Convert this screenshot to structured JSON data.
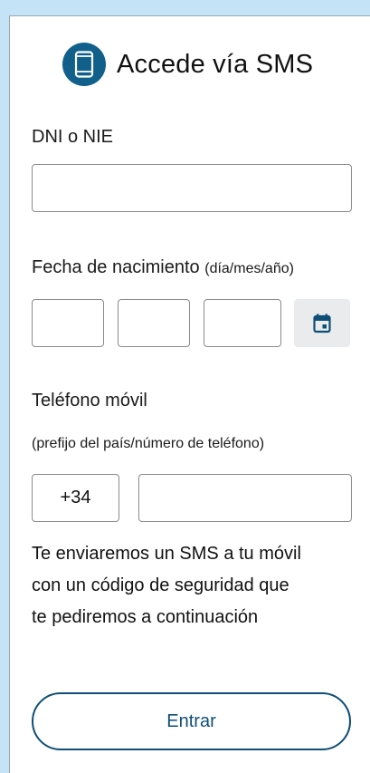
{
  "header": {
    "title": "Accede vía SMS",
    "icon": "mobile-phone-icon",
    "icon_bg": "#11608b"
  },
  "dni": {
    "label": "DNI o NIE",
    "value": ""
  },
  "birthdate": {
    "label": "Fecha de nacimiento",
    "format": "(día/mes/año)",
    "day": "",
    "month": "",
    "year": "",
    "calendar_icon": "calendar-icon"
  },
  "phone": {
    "label": "Teléfono móvil",
    "hint": "(prefijo del país/número de teléfono)",
    "prefix": "+34",
    "number": ""
  },
  "info_lines": [
    "Te enviaremos un SMS a tu móvil",
    "con un código de seguridad que",
    "te pediremos a continuación"
  ],
  "submit": {
    "label": "Entrar",
    "color": "#0f4f77"
  }
}
